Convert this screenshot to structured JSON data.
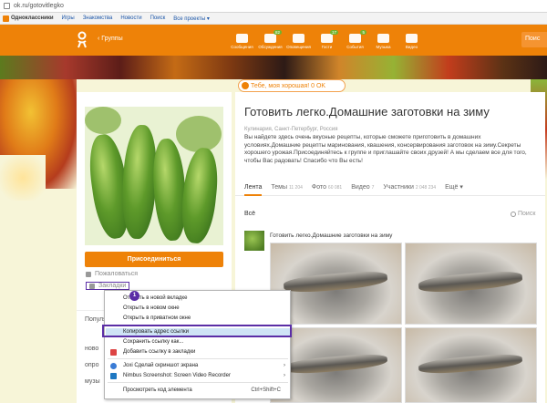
{
  "address_bar": {
    "url": "ok.ru/gotovitlegko"
  },
  "bookmarks": [
    {
      "label": "Одноклассники"
    },
    {
      "label": "Игры"
    },
    {
      "label": "Знакомства"
    },
    {
      "label": "Новости"
    },
    {
      "label": "Поиск"
    },
    {
      "label": "Все проекты ▾"
    }
  ],
  "topnav": {
    "back_label": "‹ Группы",
    "icons": [
      {
        "name": "messages-icon",
        "label": "Сообщения",
        "count": ""
      },
      {
        "name": "discussions-icon",
        "label": "Обсуждения",
        "count": "82"
      },
      {
        "name": "notifications-icon",
        "label": "Оповещения",
        "count": ""
      },
      {
        "name": "guests-icon",
        "label": "Гости",
        "count": "17"
      },
      {
        "name": "events-icon",
        "label": "События",
        "count": "5"
      },
      {
        "name": "music-icon",
        "label": "Музыка",
        "count": ""
      },
      {
        "name": "video-icon",
        "label": "Видео",
        "count": ""
      }
    ],
    "search_label": "Поис"
  },
  "banner_pill": {
    "text": "Тебе, моя хорошая! 0 OK"
  },
  "left": {
    "join_label": "Присоединиться",
    "complain_label": "Пожаловаться",
    "bookmark_label": "Закладки",
    "popular_title": "Популя",
    "popular_items": [
      "ново",
      "опро",
      "музы"
    ]
  },
  "group": {
    "title": "Готовить легко.Домашние заготовки на зиму",
    "meta": "Кулинария, Санкт-Петербург, Россия",
    "description": "Вы найдете здесь очень вкусные рецепты, которые сможете приготовить в домашних условиях.Домашние рецепты маринования, квашения, консервирования заготовок на зиму.Секреты хорошего урожая.Присоединяйтесь к группе и приглашайте своих друзей! А мы сделаем все для того, чтобы Вас радовать! Спасибо что Вы есть!",
    "tabs": [
      {
        "label": "Лента",
        "count": "",
        "active": true
      },
      {
        "label": "Темы",
        "count": "11 204"
      },
      {
        "label": "Фото",
        "count": "60 081"
      },
      {
        "label": "Видео",
        "count": "7"
      },
      {
        "label": "Участники",
        "count": "2 048 234"
      },
      {
        "label": "Ещё ▾",
        "count": ""
      }
    ]
  },
  "feed": {
    "label": "Всё",
    "search_label": "Поиск",
    "post_title": "Готовить легко.Домашние заготовки на зиму"
  },
  "context_menu": {
    "items": [
      {
        "label": "Открыть в новой вкладке"
      },
      {
        "label": "Открыть в новом окне"
      },
      {
        "label": "Открыть в приватном окне"
      },
      {
        "label": "Копировать адрес ссылки"
      },
      {
        "label": "Сохранить ссылку как..."
      },
      {
        "label": "Добавить ссылку в закладки"
      },
      {
        "label": "Joxi Сделай скриншот экрана"
      },
      {
        "label": "Nimbus Screenshot: Screen Video Recorder"
      },
      {
        "label": "Просмотреть код элемента",
        "shortcut": "Ctrl+Shift+C"
      }
    ],
    "badge": "1"
  },
  "colors": {
    "accent": "#ee8208",
    "highlight": "#5b2ea6",
    "badge_green": "#72b42d"
  }
}
